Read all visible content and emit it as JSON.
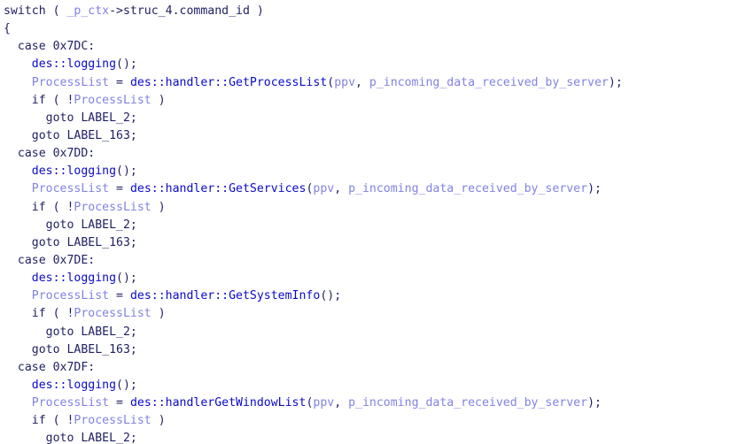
{
  "view": {
    "name": "pseudocode-listing",
    "background": "#ffffff",
    "font_size_px": 13.2,
    "line_height_px": 20.15
  },
  "colors": {
    "keyword": "#1f1f63",
    "function": "#0a0acc",
    "variable": "#8282e4",
    "number": "#1f1f63",
    "punctuation": "#1f1f63",
    "background": "#ffffff"
  },
  "code": {
    "language": "c++",
    "lines": [
      {
        "indent": 0,
        "tokens": [
          {
            "t": "switch ( ",
            "c": "kw"
          },
          {
            "t": "_p_ctx",
            "c": "var"
          },
          {
            "t": "->struc_4.command_id )",
            "c": "punc"
          }
        ]
      },
      {
        "indent": 0,
        "tokens": [
          {
            "t": "{",
            "c": "punc"
          }
        ]
      },
      {
        "indent": 2,
        "tokens": [
          {
            "t": "case ",
            "c": "kw"
          },
          {
            "t": "0x7DC:",
            "c": "num"
          }
        ]
      },
      {
        "indent": 4,
        "tokens": [
          {
            "t": "des::logging",
            "c": "fn"
          },
          {
            "t": "();",
            "c": "punc"
          }
        ]
      },
      {
        "indent": 4,
        "tokens": [
          {
            "t": "ProcessList",
            "c": "var"
          },
          {
            "t": " = ",
            "c": "punc"
          },
          {
            "t": "des::handler::GetProcessList",
            "c": "fn"
          },
          {
            "t": "(",
            "c": "punc"
          },
          {
            "t": "ppv",
            "c": "var"
          },
          {
            "t": ", ",
            "c": "punc"
          },
          {
            "t": "p_incoming_data_received_by_server",
            "c": "var"
          },
          {
            "t": ");",
            "c": "punc"
          }
        ]
      },
      {
        "indent": 4,
        "tokens": [
          {
            "t": "if ( !",
            "c": "kw"
          },
          {
            "t": "ProcessList",
            "c": "var"
          },
          {
            "t": " )",
            "c": "punc"
          }
        ]
      },
      {
        "indent": 6,
        "tokens": [
          {
            "t": "goto ",
            "c": "kw"
          },
          {
            "t": "LABEL_2;",
            "c": "lbl"
          }
        ]
      },
      {
        "indent": 4,
        "tokens": [
          {
            "t": "goto ",
            "c": "kw"
          },
          {
            "t": "LABEL_163;",
            "c": "lbl"
          }
        ]
      },
      {
        "indent": 2,
        "tokens": [
          {
            "t": "case ",
            "c": "kw"
          },
          {
            "t": "0x7DD:",
            "c": "num"
          }
        ]
      },
      {
        "indent": 4,
        "tokens": [
          {
            "t": "des::logging",
            "c": "fn"
          },
          {
            "t": "();",
            "c": "punc"
          }
        ]
      },
      {
        "indent": 4,
        "tokens": [
          {
            "t": "ProcessList",
            "c": "var"
          },
          {
            "t": " = ",
            "c": "punc"
          },
          {
            "t": "des::handler::GetServices",
            "c": "fn"
          },
          {
            "t": "(",
            "c": "punc"
          },
          {
            "t": "ppv",
            "c": "var"
          },
          {
            "t": ", ",
            "c": "punc"
          },
          {
            "t": "p_incoming_data_received_by_server",
            "c": "var"
          },
          {
            "t": ");",
            "c": "punc"
          }
        ]
      },
      {
        "indent": 4,
        "tokens": [
          {
            "t": "if ( !",
            "c": "kw"
          },
          {
            "t": "ProcessList",
            "c": "var"
          },
          {
            "t": " )",
            "c": "punc"
          }
        ]
      },
      {
        "indent": 6,
        "tokens": [
          {
            "t": "goto ",
            "c": "kw"
          },
          {
            "t": "LABEL_2;",
            "c": "lbl"
          }
        ]
      },
      {
        "indent": 4,
        "tokens": [
          {
            "t": "goto ",
            "c": "kw"
          },
          {
            "t": "LABEL_163;",
            "c": "lbl"
          }
        ]
      },
      {
        "indent": 2,
        "tokens": [
          {
            "t": "case ",
            "c": "kw"
          },
          {
            "t": "0x7DE:",
            "c": "num"
          }
        ]
      },
      {
        "indent": 4,
        "tokens": [
          {
            "t": "des::logging",
            "c": "fn"
          },
          {
            "t": "();",
            "c": "punc"
          }
        ]
      },
      {
        "indent": 4,
        "tokens": [
          {
            "t": "ProcessList",
            "c": "var"
          },
          {
            "t": " = ",
            "c": "punc"
          },
          {
            "t": "des::handler::GetSystemInfo",
            "c": "fn"
          },
          {
            "t": "();",
            "c": "punc"
          }
        ]
      },
      {
        "indent": 4,
        "tokens": [
          {
            "t": "if ( !",
            "c": "kw"
          },
          {
            "t": "ProcessList",
            "c": "var"
          },
          {
            "t": " )",
            "c": "punc"
          }
        ]
      },
      {
        "indent": 6,
        "tokens": [
          {
            "t": "goto ",
            "c": "kw"
          },
          {
            "t": "LABEL_2;",
            "c": "lbl"
          }
        ]
      },
      {
        "indent": 4,
        "tokens": [
          {
            "t": "goto ",
            "c": "kw"
          },
          {
            "t": "LABEL_163;",
            "c": "lbl"
          }
        ]
      },
      {
        "indent": 2,
        "tokens": [
          {
            "t": "case ",
            "c": "kw"
          },
          {
            "t": "0x7DF:",
            "c": "num"
          }
        ]
      },
      {
        "indent": 4,
        "tokens": [
          {
            "t": "des::logging",
            "c": "fn"
          },
          {
            "t": "();",
            "c": "punc"
          }
        ]
      },
      {
        "indent": 4,
        "tokens": [
          {
            "t": "ProcessList",
            "c": "var"
          },
          {
            "t": " = ",
            "c": "punc"
          },
          {
            "t": "des::handlerGetWindowList",
            "c": "fn"
          },
          {
            "t": "(",
            "c": "punc"
          },
          {
            "t": "ppv",
            "c": "var"
          },
          {
            "t": ", ",
            "c": "punc"
          },
          {
            "t": "p_incoming_data_received_by_server",
            "c": "var"
          },
          {
            "t": ");",
            "c": "punc"
          }
        ]
      },
      {
        "indent": 4,
        "tokens": [
          {
            "t": "if ( !",
            "c": "kw"
          },
          {
            "t": "ProcessList",
            "c": "var"
          },
          {
            "t": " )",
            "c": "punc"
          }
        ]
      },
      {
        "indent": 6,
        "tokens": [
          {
            "t": "goto ",
            "c": "kw"
          },
          {
            "t": "LABEL_2;",
            "c": "lbl"
          }
        ]
      }
    ]
  }
}
